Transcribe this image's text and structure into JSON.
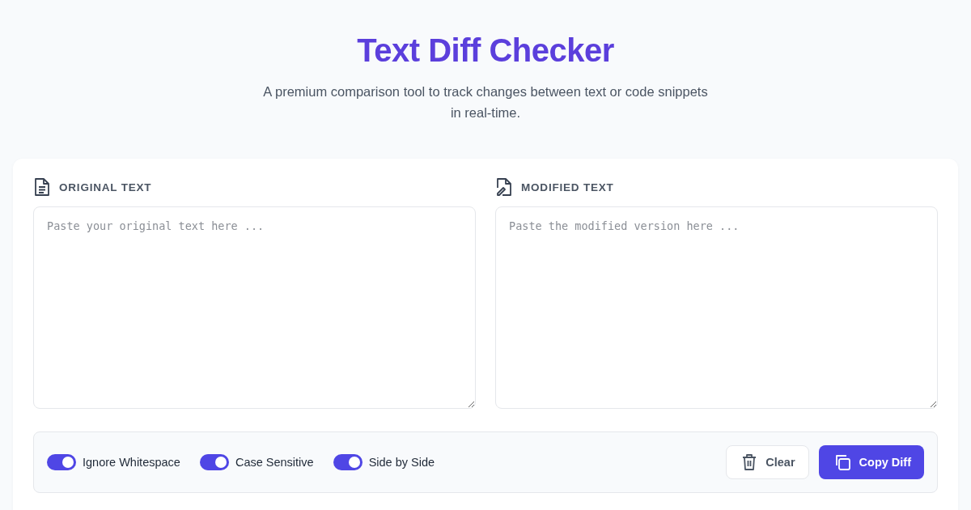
{
  "header": {
    "title": "Text Diff Checker",
    "subtitle": "A premium comparison tool to track changes between text or code snippets in real-time."
  },
  "panels": [
    {
      "kind": "original",
      "label": "ORIGINAL TEXT",
      "placeholder": "Paste your original text here ..."
    },
    {
      "kind": "modified",
      "label": "MODIFIED TEXT",
      "placeholder": "Paste the modified version here ..."
    }
  ],
  "options": [
    {
      "label": "Ignore Whitespace",
      "on": true
    },
    {
      "label": "Case Sensitive",
      "on": true
    },
    {
      "label": "Side by Side",
      "on": true
    }
  ],
  "actions": [
    {
      "kind": "clear",
      "label": "Clear"
    },
    {
      "kind": "copy",
      "label": "Copy Diff"
    }
  ]
}
